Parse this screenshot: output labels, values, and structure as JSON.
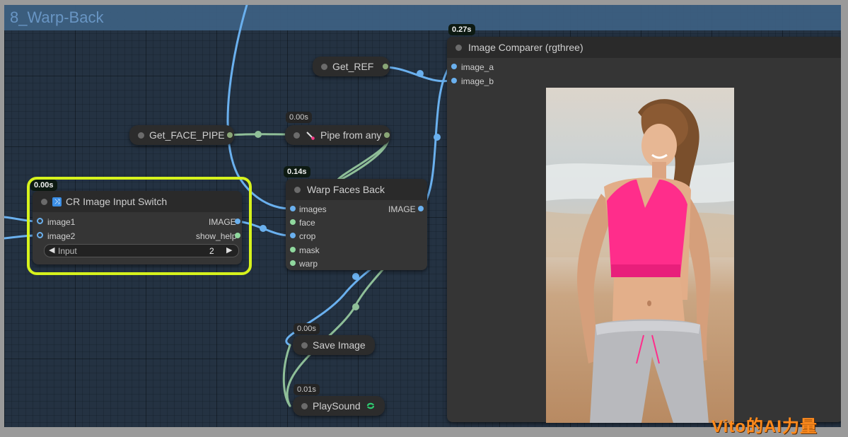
{
  "group": {
    "title": "8_Warp-Back"
  },
  "nodes": {
    "get_ref": {
      "label": "Get_REF"
    },
    "get_face_pipe": {
      "label": "Get_FACE_PIPE"
    },
    "pipe_from_any": {
      "label": "Pipe from any",
      "time": "0.00s",
      "icon": "wand-icon"
    },
    "warp_faces_back": {
      "label": "Warp Faces Back",
      "time": "0.14s",
      "inputs": [
        "images",
        "face",
        "crop",
        "mask",
        "warp"
      ],
      "output": "IMAGE"
    },
    "cr_image_input_switch": {
      "label": "CR Image Input Switch",
      "time": "0.00s",
      "icon": "shuffle-icon",
      "inputs": [
        "image1",
        "image2"
      ],
      "outputs": [
        "IMAGE",
        "show_help"
      ],
      "widget": {
        "name": "Input",
        "value": "2"
      }
    },
    "image_comparer": {
      "label": "Image Comparer (rgthree)",
      "time": "0.27s",
      "inputs": [
        "image_a",
        "image_b"
      ]
    },
    "save_image": {
      "label": "Save Image",
      "time": "0.00s"
    },
    "play_sound": {
      "label": "PlaySound",
      "time": "0.01s",
      "icon": "loop-icon"
    }
  },
  "colors": {
    "image_wire": "#6ab0ee",
    "pipe_wire": "#8fbf98",
    "highlight": "#d6f21d",
    "watermark": "#ff8b1e"
  },
  "watermark": "Vito的AI力量"
}
